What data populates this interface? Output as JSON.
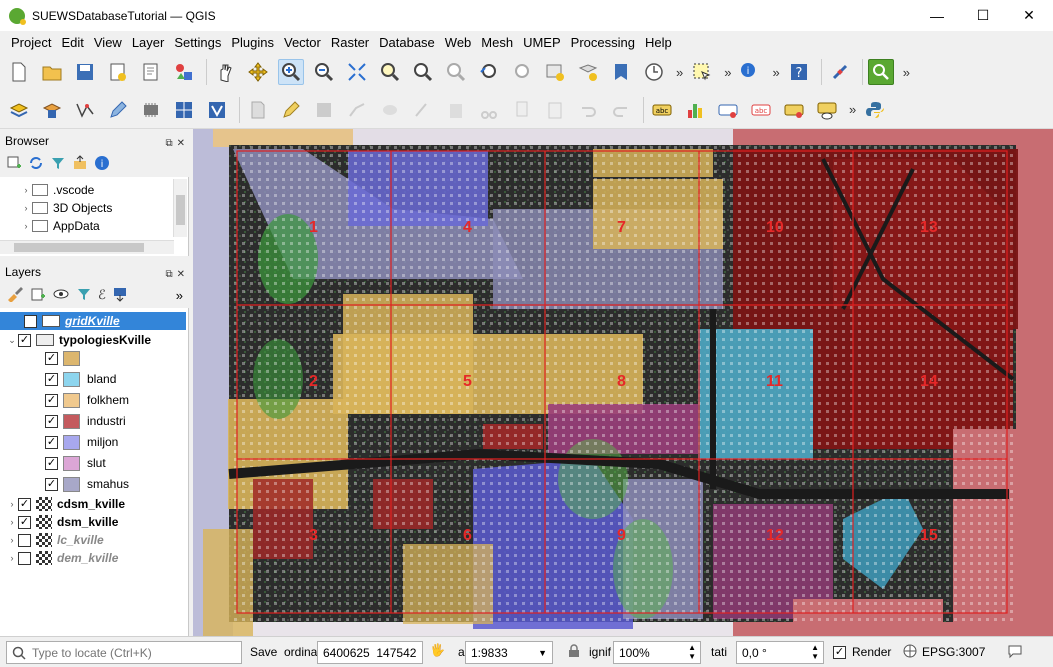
{
  "window": {
    "title": "SUEWSDatabaseTutorial — QGIS",
    "minimize": "—",
    "maximize": "☐",
    "close": "✕"
  },
  "menu": [
    "Project",
    "Edit",
    "View",
    "Layer",
    "Settings",
    "Plugins",
    "Vector",
    "Raster",
    "Database",
    "Web",
    "Mesh",
    "UMEP",
    "Processing",
    "Help"
  ],
  "toolbar": {
    "overflow": "»"
  },
  "browser": {
    "title": "Browser",
    "items": [
      ".vscode",
      "3D Objects",
      "AppData"
    ]
  },
  "layers": {
    "title": "Layers",
    "tree": [
      {
        "name": "gridKville",
        "checked": true,
        "selected": true,
        "style": "italic-bold"
      },
      {
        "name": "typologiesKville",
        "checked": true,
        "style": "bold"
      },
      {
        "name": "",
        "checked": true,
        "color": "#dcb66e"
      },
      {
        "name": "bland",
        "checked": true,
        "color": "#8dd5ee"
      },
      {
        "name": "folkhem",
        "checked": true,
        "color": "#f0c98e"
      },
      {
        "name": "industri",
        "checked": true,
        "color": "#c45a5e"
      },
      {
        "name": "miljon",
        "checked": true,
        "color": "#a8a8ee"
      },
      {
        "name": "slut",
        "checked": true,
        "color": "#dca6d6"
      },
      {
        "name": "smahus",
        "checked": true,
        "color": "#a8a8c8"
      },
      {
        "name": "cdsm_kville",
        "checked": true,
        "style": "bold"
      },
      {
        "name": "dsm_kville",
        "checked": true,
        "style": "bold"
      },
      {
        "name": "lc_kville",
        "checked": false,
        "style": "italic-bold-gray"
      },
      {
        "name": "dem_kville",
        "checked": false,
        "style": "italic-bold-gray"
      }
    ]
  },
  "map": {
    "grid_labels": [
      "1",
      "2",
      "3",
      "4",
      "5",
      "6",
      "7",
      "8",
      "9",
      "10",
      "11",
      "12",
      "13",
      "14",
      "15"
    ],
    "grid_color": "#e02020"
  },
  "status": {
    "locate_placeholder": "Type to locate (Ctrl+K)",
    "save_label": "Save",
    "coordinate_label": "ordina",
    "coordinate_value": "6400625  147542",
    "scale_label": "a",
    "scale_value": "1:9833",
    "magnifier_label": "ignif",
    "magnifier_value": "100%",
    "rotation_label": "tati",
    "rotation_value": "0,0 °",
    "render_label": "Render",
    "crs": "EPSG:3007"
  }
}
